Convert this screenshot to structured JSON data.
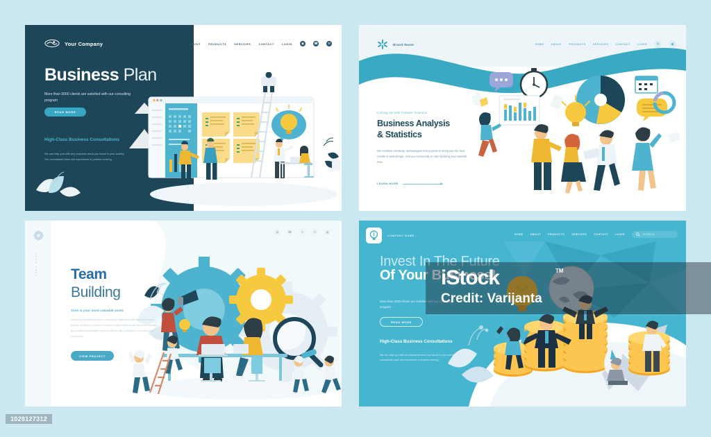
{
  "templates": [
    {
      "id": "business-plan",
      "logo_name": "Your Company",
      "nav": [
        "ABOUT",
        "PRODUCTS",
        "SERVICES",
        "CONTACT",
        "LOGIN"
      ],
      "nav_icons": [
        "globe-icon",
        "phone-icon",
        "mail-icon"
      ],
      "title_bold": "Business",
      "title_light": "Plan",
      "subtitle": "More than 5000 clients are satisfied with our consulting program",
      "cta": "READ MORE",
      "section_title": "High-Class Business Consultations",
      "body": "We can help you with any business issue you faced in your activity. Our consultants have rich experience in problem solving.",
      "colors": {
        "bg_dark": "#1d4659",
        "accent": "#39a7c4",
        "heading": "#4fb3cc"
      }
    },
    {
      "id": "business-analysis",
      "logo_name": "Brand Name",
      "nav": [
        "HOME",
        "ABOUT",
        "PRODUCTS",
        "SERVICES",
        "CONTACT",
        "LOGIN"
      ],
      "nav_icons": [
        "search-icon",
        "user-icon"
      ],
      "eyebrow": "Coming Up With Creative Solutions",
      "title_line1": "Business Analysis",
      "title_line2": "& Statistics",
      "body": "We combine creativity, technologies and passion to bring you the best results in web design. Join our community to start building your website now.",
      "cta": "LEARN MORE",
      "colors": {
        "wave": "#3aa9c4",
        "top_bg": "#eef5f8",
        "heading": "#1c4a5c"
      }
    },
    {
      "id": "team-building",
      "vertical_text": "TEAM WORK",
      "nav_icons": [
        "globe-icon",
        "phone-icon",
        "pin-icon",
        "mail-icon",
        "chat-icon"
      ],
      "title_bold": "Team",
      "title_light": "Building",
      "tagline": "Time is your most valuable asset.",
      "body": "Lorem ipsum dolor sit amet, consectetur adipiscing elit sed do eiusmod tempor incididunt ut labore et dolore magna aliqua enim ad minim veniam quis nostrud exercitation ullamco laboris nisi ut aliquip ex ea commodo consequat.",
      "cta": "VIEW PROJECT",
      "colors": {
        "accent": "#49a9c6",
        "title": "#2a6ca8",
        "rail": "#f4f9fb"
      }
    },
    {
      "id": "invest-future",
      "logo_name": "COMPANY NAME",
      "logo_icon": "lightbulb-icon",
      "nav": [
        "HOME",
        "ABOUT",
        "PRODUCTS",
        "SERVICES",
        "CONTACT",
        "LOGIN"
      ],
      "search_placeholder": "SEARCH",
      "search_icon": "search-icon",
      "title_line1": "Invest In The Future",
      "title_line2": "Of Your Business!",
      "subtitle": "More than 5000 clients are satisfied with our consulting program",
      "cta": "READ MORE",
      "section_title": "High-Class Business Consultations",
      "body": "We can help you with any business issue you faced in your activity. Our consultants have rich experience in problem solving.",
      "colors": {
        "bg": "#45b5d0",
        "search_bg": "#5ec0d7"
      }
    }
  ],
  "watermark": {
    "brand": "iStock",
    "tm": "TM",
    "credit": "Credit: Varijanta"
  },
  "image_id": "1028127312",
  "page_background": "#cbe7ef"
}
